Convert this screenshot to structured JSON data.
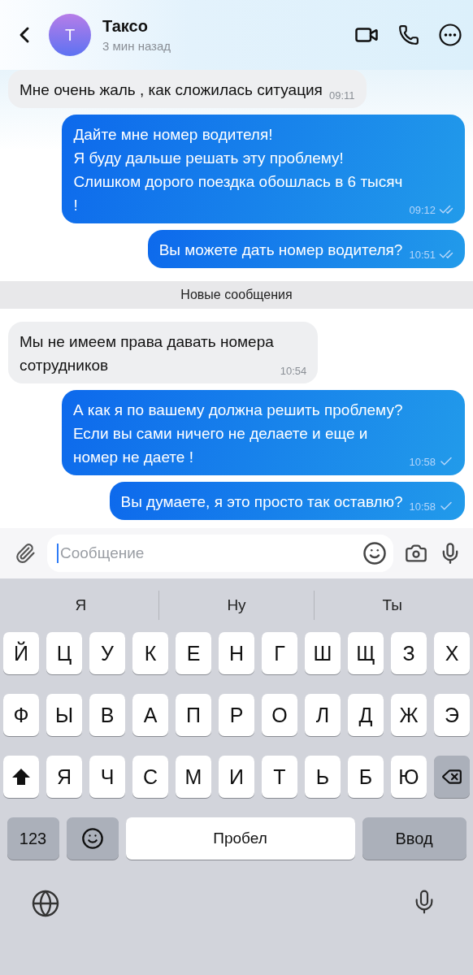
{
  "header": {
    "avatar_letter": "Т",
    "name": "Таксо",
    "status": "3 мин назад"
  },
  "messages": [
    {
      "kind": "incoming",
      "text": "Мне очень жаль , как сложилась ситуация",
      "time": "09:11"
    },
    {
      "kind": "outgoing",
      "text": "Дайте мне номер водителя!\nЯ буду дальше решать эту проблему!\nСлишком дорого поездка обошлась в 6 тысяч\n!",
      "time": "09:12",
      "read": true
    },
    {
      "kind": "outgoing",
      "text": "Вы можете дать номер водителя?",
      "time": "10:51",
      "read": true
    },
    {
      "kind": "divider",
      "text": "Новые сообщения"
    },
    {
      "kind": "incoming",
      "text": "Мы не имеем права давать номера\nсотрудников",
      "time": "10:54"
    },
    {
      "kind": "outgoing",
      "text": "А как я по вашему должна решить проблему?\nЕсли вы сами ничего не делаете и еще и\nномер не даете !",
      "time": "10:58",
      "read": false
    },
    {
      "kind": "outgoing",
      "text": "Вы думаете, я это просто так оставлю?",
      "time": "10:58",
      "read": false
    }
  ],
  "composer": {
    "placeholder": "Сообщение"
  },
  "keyboard": {
    "suggestions": [
      "Я",
      "Ну",
      "Ты"
    ],
    "rows": [
      [
        {
          "kind": "letter",
          "label": "Й"
        },
        {
          "kind": "letter",
          "label": "Ц"
        },
        {
          "kind": "letter",
          "label": "У"
        },
        {
          "kind": "letter",
          "label": "К"
        },
        {
          "kind": "letter",
          "label": "Е"
        },
        {
          "kind": "letter",
          "label": "Н"
        },
        {
          "kind": "letter",
          "label": "Г"
        },
        {
          "kind": "letter",
          "label": "Ш"
        },
        {
          "kind": "letter",
          "label": "Щ"
        },
        {
          "kind": "letter",
          "label": "З"
        },
        {
          "kind": "letter",
          "label": "Х"
        }
      ],
      [
        {
          "kind": "letter",
          "label": "Ф"
        },
        {
          "kind": "letter",
          "label": "Ы"
        },
        {
          "kind": "letter",
          "label": "В"
        },
        {
          "kind": "letter",
          "label": "А"
        },
        {
          "kind": "letter",
          "label": "П"
        },
        {
          "kind": "letter",
          "label": "Р"
        },
        {
          "kind": "letter",
          "label": "О"
        },
        {
          "kind": "letter",
          "label": "Л"
        },
        {
          "kind": "letter",
          "label": "Д"
        },
        {
          "kind": "letter",
          "label": "Ж"
        },
        {
          "kind": "letter",
          "label": "Э"
        }
      ],
      [
        {
          "kind": "shift"
        },
        {
          "kind": "letter",
          "label": "Я"
        },
        {
          "kind": "letter",
          "label": "Ч"
        },
        {
          "kind": "letter",
          "label": "С"
        },
        {
          "kind": "letter",
          "label": "М"
        },
        {
          "kind": "letter",
          "label": "И"
        },
        {
          "kind": "letter",
          "label": "Т"
        },
        {
          "kind": "letter",
          "label": "Ь"
        },
        {
          "kind": "letter",
          "label": "Б"
        },
        {
          "kind": "letter",
          "label": "Ю"
        },
        {
          "kind": "backspace"
        }
      ]
    ],
    "bottom_row": [
      {
        "kind": "special",
        "label": "123"
      },
      {
        "kind": "emoji"
      },
      {
        "kind": "space",
        "label": "Пробел"
      },
      {
        "kind": "special",
        "label": "Ввод"
      }
    ]
  }
}
